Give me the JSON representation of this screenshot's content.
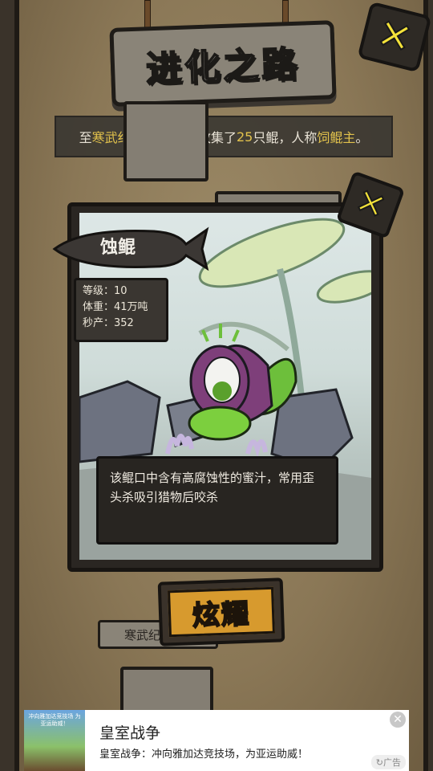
{
  "title": "进化之路",
  "summary": {
    "prefix": "至",
    "era": "寒武纪11亿年",
    "mid": "，你收集了",
    "count": "25",
    "mid2": "只鲲，人称",
    "rank": "饲鲲主",
    "suffix": "。"
  },
  "card": {
    "name": "蚀鲲",
    "stats": [
      {
        "label": "等级：",
        "value": "10"
      },
      {
        "label": "体重：",
        "value": "41万吨"
      },
      {
        "label": "秒产：",
        "value": "352"
      }
    ],
    "description": "该鲲口中含有高腐蚀性的蜜汁，常用歪头杀吸引猎物后咬杀"
  },
  "show_button": "炫耀",
  "era_tag": "寒武纪",
  "ad": {
    "image_text": "冲向雅加达竞技场 为亚运助威！",
    "title": "皇室战争",
    "body": "皇室战争：冲向雅加达竞技场，为亚运助威！",
    "label": "广告"
  },
  "colors": {
    "highlight": "#e2c24c",
    "close_x": "#f4e23a",
    "button": "#d79a2e"
  },
  "icons": {
    "close": "close-x-icon",
    "ad_close": "close-icon"
  }
}
